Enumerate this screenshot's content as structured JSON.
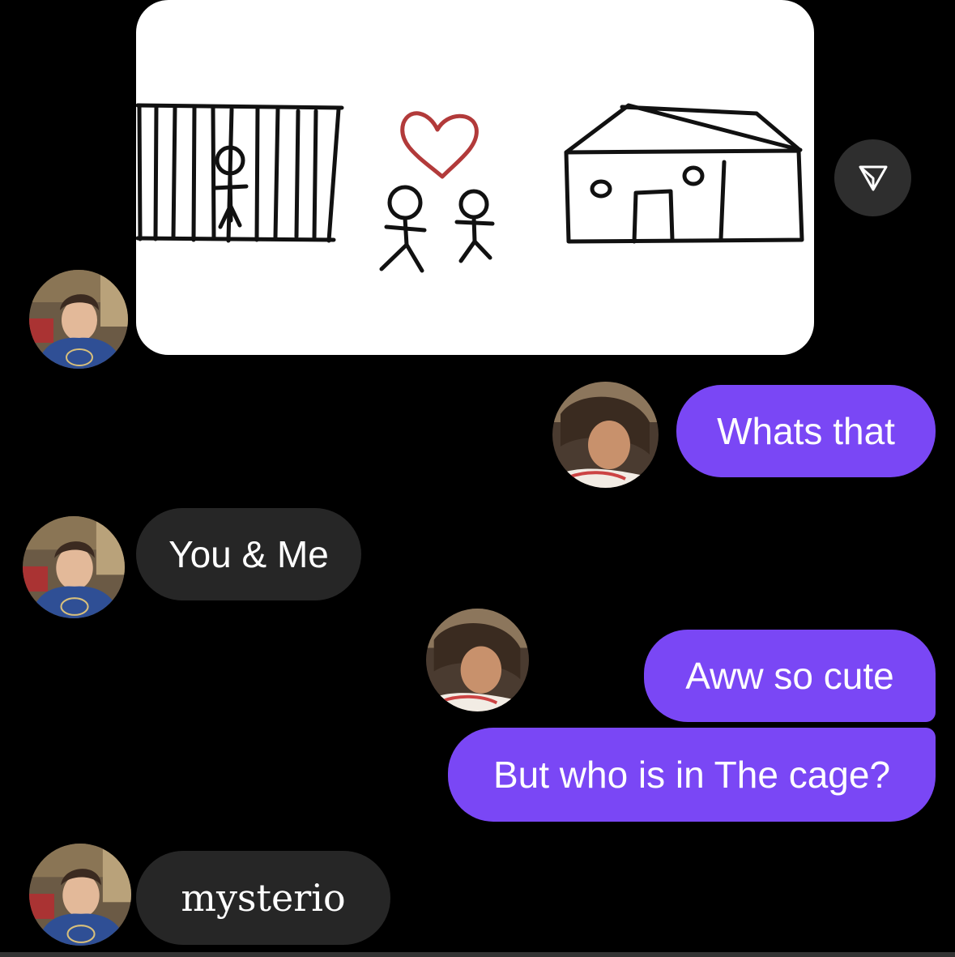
{
  "conversation": {
    "shared_image": {
      "icon": "stick-figure-drawing"
    },
    "send_button": {
      "icon": "paper-plane-icon"
    },
    "messages": [
      {
        "sender": "other",
        "text": "You & Me"
      },
      {
        "sender": "me",
        "text": "Whats that"
      },
      {
        "sender": "me",
        "text": "Aww so cute"
      },
      {
        "sender": "me",
        "text": "But who is in The cage?"
      },
      {
        "sender": "other",
        "text": "mysterio"
      }
    ]
  },
  "colors": {
    "background": "#000000",
    "sent_bubble": "#7a47f5",
    "received_bubble": "#262626",
    "text": "#ffffff"
  }
}
